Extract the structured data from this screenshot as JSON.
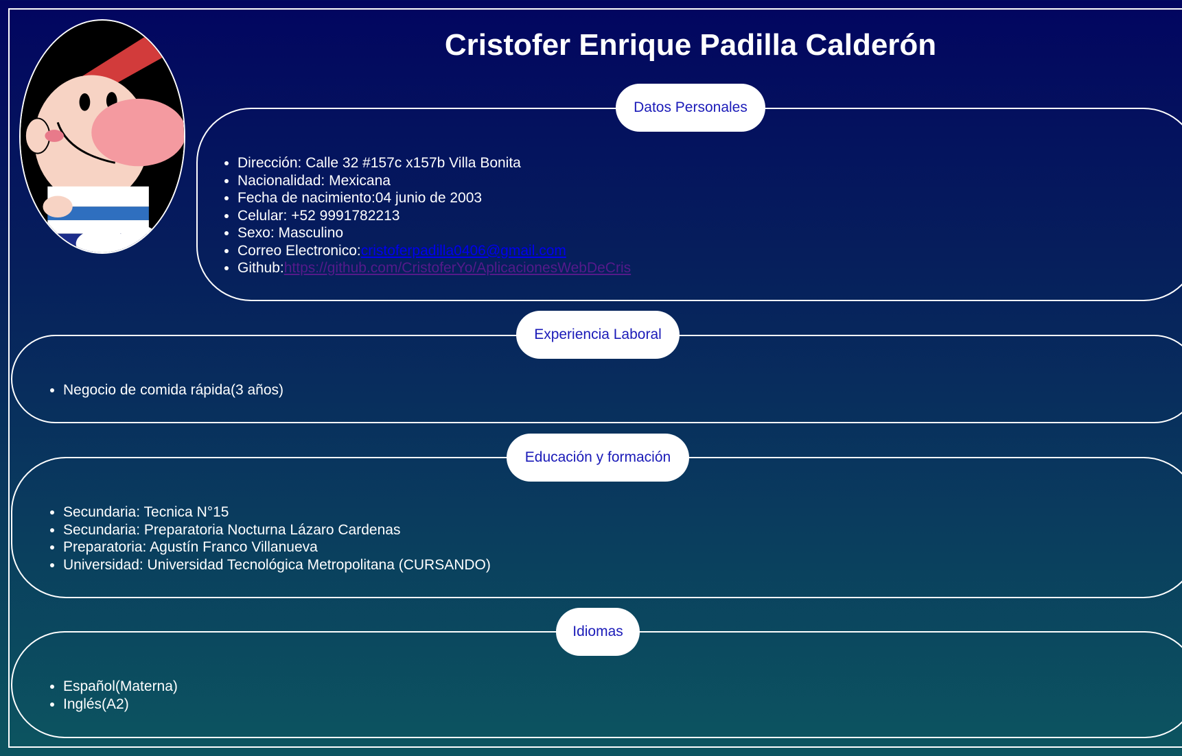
{
  "header": {
    "name": "Cristofer Enrique Padilla Calderón"
  },
  "avatar": {
    "alt": "cartoon avatar"
  },
  "datos_personales": {
    "title": "Datos Personales",
    "direccion": "Dirección: Calle 32 #157c x157b Villa Bonita",
    "nacionalidad": "Nacionalidad: Mexicana",
    "nacimiento": "Fecha de nacimiento:04 junio de 2003",
    "celular": "Celular: +52 9991782213",
    "sexo": "Sexo: Masculino",
    "correo_label": "Correo Electronico:",
    "correo_link": "cristoferpadilla0406@gmail.com",
    "github_label": "Github:",
    "github_link": "https://github.com/CristoferYo/AplicacionesWebDeCris"
  },
  "experiencia": {
    "title": "Experiencia Laboral",
    "items": [
      "Negocio de comida rápida(3 años)"
    ]
  },
  "educacion": {
    "title": "Educación y formación",
    "items": [
      "Secundaria: Tecnica N°15",
      "Secundaria: Preparatoria Nocturna Lázaro Cardenas",
      "Preparatoria: Agustín Franco Villanueva",
      "Universidad: Universidad Tecnológica Metropolitana (CURSANDO)"
    ]
  },
  "idiomas": {
    "title": "Idiomas",
    "items": [
      "Español(Materna)",
      "Inglés(A2)"
    ]
  },
  "colors": {
    "background_top": "#020560",
    "background_bottom": "#0c5560",
    "pill_text": "#1a1ab8",
    "link": "#0000ee",
    "visited_link": "#551a8b"
  }
}
